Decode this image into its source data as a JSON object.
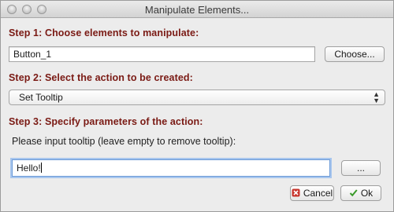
{
  "window": {
    "title": "Manipulate Elements..."
  },
  "step1": {
    "heading": "Step 1: Choose elements to manipulate:",
    "element_value": "Button_1",
    "choose_label": "Choose..."
  },
  "step2": {
    "heading": "Step 2: Select the action to be created:",
    "action_selected": "Set Tooltip"
  },
  "step3": {
    "heading": "Step 3: Specify parameters of the action:",
    "prompt": "Please input tooltip (leave empty to remove tooltip):",
    "tooltip_value": "Hello!",
    "more_label": "..."
  },
  "footer": {
    "cancel_label": "Cancel",
    "ok_label": "Ok"
  },
  "colors": {
    "heading": "#7a1a14",
    "focus_ring": "#6c9bd8",
    "cancel_icon": "#c8362e",
    "ok_icon": "#3a9a2a"
  },
  "icons": {
    "cancel": "cancel-x-icon",
    "ok": "ok-check-icon"
  }
}
